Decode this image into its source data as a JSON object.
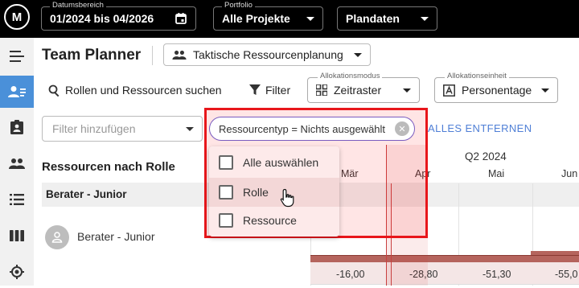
{
  "topbar": {
    "logo_text": "M",
    "date_range": {
      "legend": "Datumsbereich",
      "value": "01/2024 bis 04/2026"
    },
    "portfolio": {
      "legend": "Portfolio",
      "value": "Alle Projekte"
    },
    "dataset": {
      "value": "Plandaten"
    }
  },
  "sidebar": {
    "items": [
      {
        "icon": "menu-icon",
        "active": false
      },
      {
        "icon": "team-planner-icon",
        "active": true
      },
      {
        "icon": "assignment-icon",
        "active": false
      },
      {
        "icon": "people-icon",
        "active": false
      },
      {
        "icon": "list-icon",
        "active": false
      },
      {
        "icon": "columns-icon",
        "active": false
      },
      {
        "icon": "target-icon",
        "active": false
      }
    ]
  },
  "header": {
    "title": "Team Planner",
    "view_select": "Taktische Ressourcenplanung"
  },
  "toolbar": {
    "search_label": "Rollen und Ressourcen suchen",
    "filter_label": "Filter",
    "allocation_mode": {
      "legend": "Allokationsmodus",
      "value": "Zeitraster"
    },
    "allocation_unit": {
      "legend": "Allokationseinheit",
      "value": "Personentage"
    }
  },
  "filters": {
    "input_placeholder": "Filter hinzufügen",
    "chip_label": "Ressourcentyp = Nichts ausgewählt",
    "remove_all": "ALLES ENTFERNEN"
  },
  "dropdown": {
    "items": [
      {
        "label": "Alle auswählen",
        "checked": false
      },
      {
        "label": "Rolle",
        "checked": false
      },
      {
        "label": "Ressource",
        "checked": false
      }
    ]
  },
  "table": {
    "title": "Ressourcen nach Rolle",
    "group_label": "Berater - Junior",
    "resource_label": "Berater - Junior"
  },
  "timeline": {
    "quarter": "Q2 2024",
    "months": [
      "Mär",
      "Apr",
      "Mai",
      "Jun"
    ],
    "values": [
      "-16,00",
      "-28,80",
      "-51,30",
      "-55,0"
    ]
  },
  "colors": {
    "highlight": "#e8161b",
    "accent_link": "#4f7fd6",
    "chip_border": "#7a5cc0",
    "bar": "#b5645d",
    "active_sidebar": "#4a90d9"
  }
}
